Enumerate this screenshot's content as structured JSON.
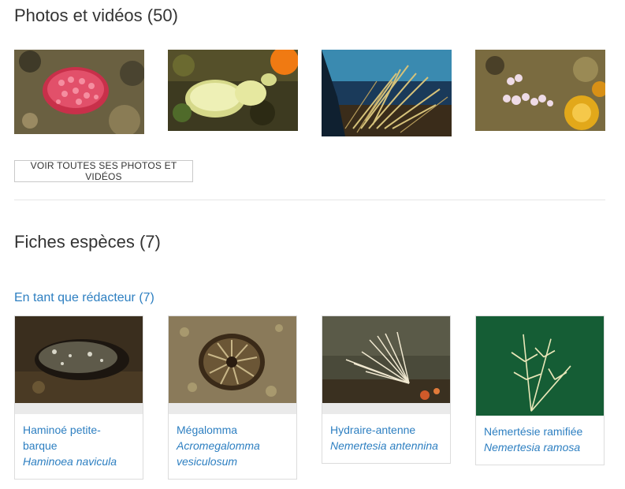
{
  "photos_section": {
    "title": "Photos et vidéos (50)",
    "button_label": "VOIR TOUTES SES PHOTOS ET VIDÉOS",
    "thumbnails": [
      {
        "subject": "pink-anemone"
      },
      {
        "subject": "white-sea-slug"
      },
      {
        "subject": "hydroid-seascape"
      },
      {
        "subject": "soft-coral-reef"
      }
    ]
  },
  "species_section": {
    "title": "Fiches espèces (7)",
    "subheading": "En tant que rédacteur (7)",
    "cards": [
      {
        "name": "Haminoé petite-barque",
        "scientific": "Haminoea navicula"
      },
      {
        "name": "Mégalomma",
        "scientific": "Acromegalomma vesiculosum"
      },
      {
        "name": "Hydraire-antenne",
        "scientific": "Nemertesia antennina"
      },
      {
        "name": "Némertésie ramifiée",
        "scientific": "Nemertesia ramosa"
      }
    ]
  },
  "colors": {
    "link": "#2d7fc1",
    "text": "#333333",
    "border": "#dcdcdc"
  }
}
